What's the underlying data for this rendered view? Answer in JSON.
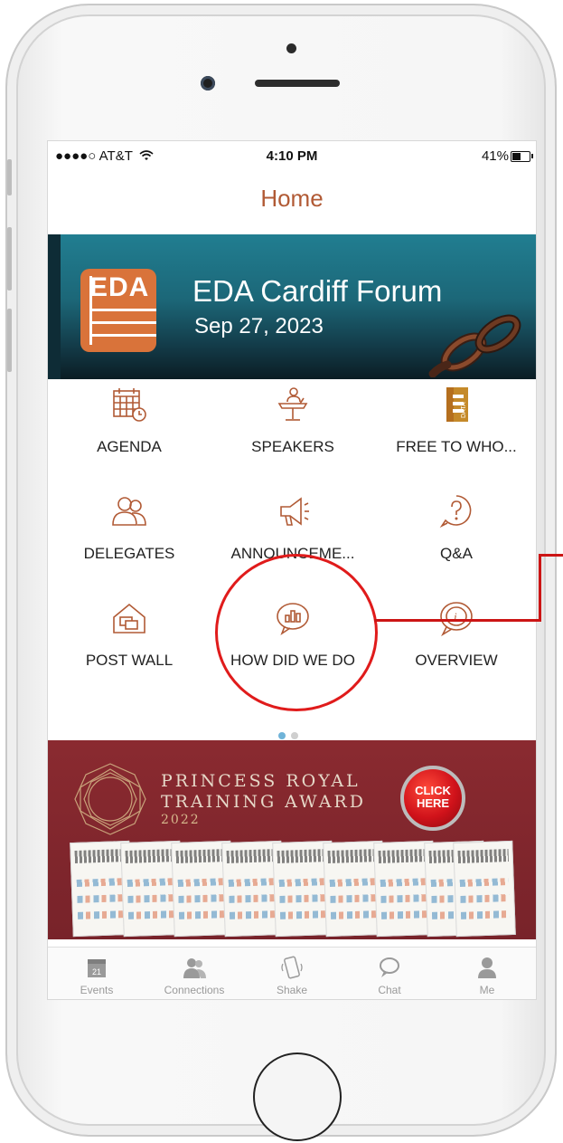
{
  "status_bar": {
    "carrier": "●●●●○ AT&T",
    "wifi_icon": "wifi-icon",
    "time": "4:10 PM",
    "battery": "41%"
  },
  "header": {
    "title": "Home"
  },
  "banner": {
    "logo_text": "EDA",
    "title": "EDA Cardiff Forum",
    "date": "Sep 27, 2023"
  },
  "menu": {
    "items": [
      {
        "label": "AGENDA",
        "icon": "agenda-calendar-icon"
      },
      {
        "label": "SPEAKERS",
        "icon": "speaker-podium-icon"
      },
      {
        "label": "FREE TO WHO...",
        "icon": "data-chart-icon"
      },
      {
        "label": "DELEGATES",
        "icon": "delegates-people-icon"
      },
      {
        "label": "ANNOUNCEME...",
        "icon": "megaphone-icon"
      },
      {
        "label": "Q&A",
        "icon": "question-bubble-icon"
      },
      {
        "label": "POST WALL",
        "icon": "post-wall-icon"
      },
      {
        "label": "HOW DID WE DO",
        "icon": "feedback-chart-icon"
      },
      {
        "label": "OVERVIEW",
        "icon": "info-bubble-icon"
      }
    ],
    "page_indicator": {
      "current": 1,
      "total": 2
    }
  },
  "promo": {
    "line1": "PRINCESS ROYAL",
    "line2": "TRAINING AWARD",
    "year": "2022",
    "button_line1": "CLICK",
    "button_line2": "HERE"
  },
  "tab_bar": {
    "items": [
      {
        "label": "Events",
        "icon": "calendar-icon",
        "calendar_day": "21"
      },
      {
        "label": "Connections",
        "icon": "people-icon"
      },
      {
        "label": "Shake",
        "icon": "phone-shake-icon"
      },
      {
        "label": "Chat",
        "icon": "chat-icon"
      },
      {
        "label": "Me",
        "icon": "person-icon"
      }
    ]
  },
  "colors": {
    "accent": "#b15a35",
    "banner": "#1c6778",
    "promo": "#7f262d",
    "annotation": "#e01b1b",
    "dot_active": "#6fb3d8",
    "dot_inactive": "#cfcfcf"
  }
}
